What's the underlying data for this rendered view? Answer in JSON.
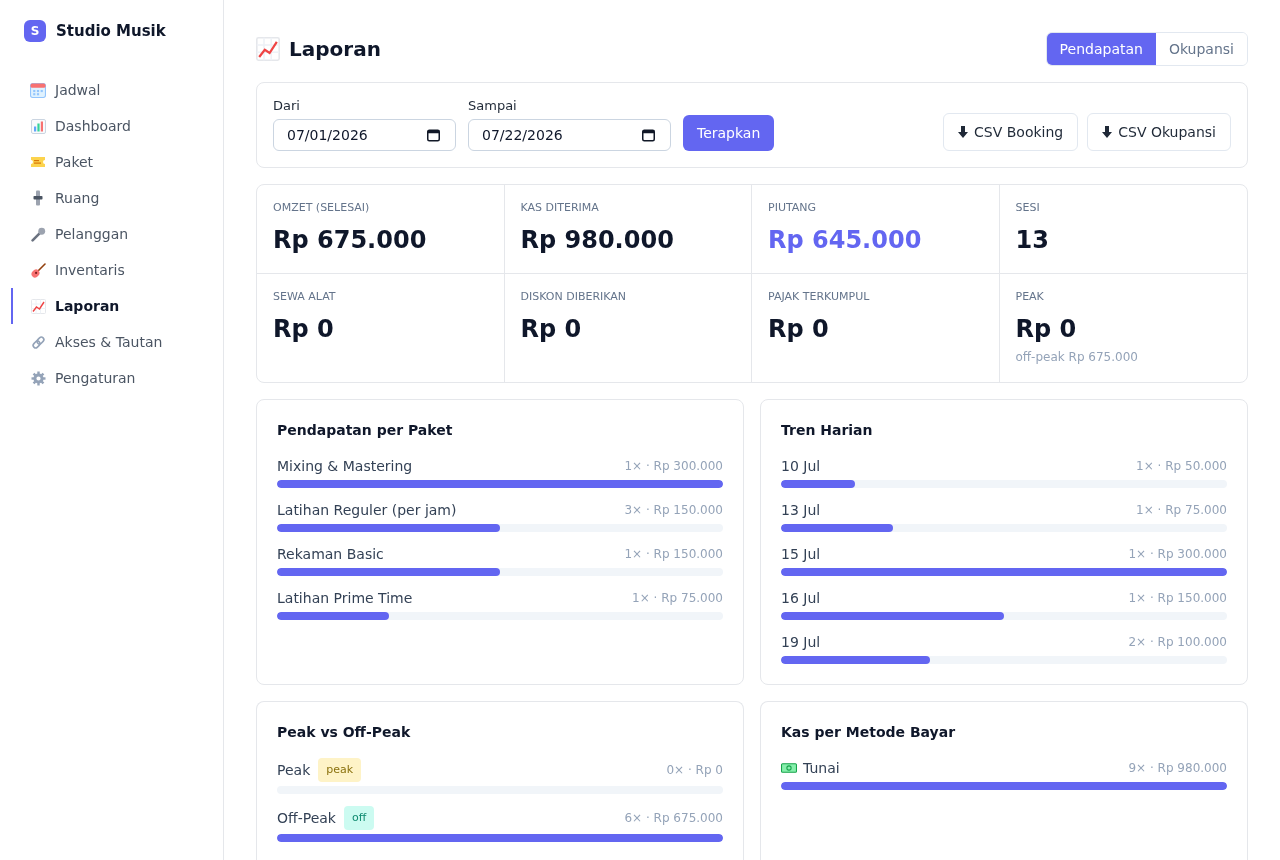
{
  "sidebar": {
    "brand": {
      "logo": "S",
      "name": "Studio Musik"
    },
    "items": [
      {
        "label": "Jadwal",
        "selected": false
      },
      {
        "label": "Dashboard",
        "selected": false
      },
      {
        "label": "Paket",
        "selected": false
      },
      {
        "label": "Ruang",
        "selected": false
      },
      {
        "label": "Pelanggan",
        "selected": false
      },
      {
        "label": "Inventaris",
        "selected": false
      },
      {
        "label": "Laporan",
        "selected": true
      },
      {
        "label": "Akses & Tautan",
        "selected": false
      },
      {
        "label": "Pengaturan",
        "selected": false
      }
    ]
  },
  "header": {
    "title": "Laporan",
    "view_tabs": [
      {
        "label": "Pendapatan",
        "selected": true
      },
      {
        "label": "Okupansi",
        "selected": false
      }
    ]
  },
  "filters": {
    "date_fields": [
      {
        "label": "Dari",
        "value": "07/01/2026"
      },
      {
        "label": "Sampai",
        "value": "07/22/2026"
      }
    ],
    "apply_button": "Terapkan",
    "export_buttons": [
      "CSV Booking",
      "CSV Okupansi"
    ]
  },
  "stats": [
    {
      "label": "OMZET (SELESAI)",
      "value": "Rp 675.000",
      "accent": false
    },
    {
      "label": "KAS DITERIMA",
      "value": "Rp 980.000",
      "accent": false
    },
    {
      "label": "PIUTANG",
      "value": "Rp 645.000",
      "accent": true
    },
    {
      "label": "SESI",
      "value": "13",
      "accent": false
    },
    {
      "label": "SEWA ALAT",
      "value": "Rp 0",
      "accent": false
    },
    {
      "label": "DISKON DIBERIKAN",
      "value": "Rp 0",
      "accent": false
    },
    {
      "label": "PAJAK TERKUMPUL",
      "value": "Rp 0",
      "accent": false
    },
    {
      "label": "PEAK",
      "value": "Rp 0",
      "note": "off-peak Rp 675.000",
      "accent": false
    }
  ],
  "panels": [
    {
      "title": "Pendapatan per Paket",
      "kind": "bars",
      "rows": [
        {
          "label": "Mixing & Mastering",
          "reading": "1× · Rp 300.000",
          "level": 1
        },
        {
          "label": "Latihan Reguler (per jam)",
          "reading": "3× · Rp 150.000",
          "level": 0.5
        },
        {
          "label": "Rekaman Basic",
          "reading": "1× · Rp 150.000",
          "level": 0.5
        },
        {
          "label": "Latihan Prime Time",
          "reading": "1× · Rp 75.000",
          "level": 0.25
        }
      ]
    },
    {
      "title": "Tren Harian",
      "kind": "bars",
      "rows": [
        {
          "label": "10 Jul",
          "reading": "1× · Rp 50.000",
          "level": 0.167
        },
        {
          "label": "13 Jul",
          "reading": "1× · Rp 75.000",
          "level": 0.25
        },
        {
          "label": "15 Jul",
          "reading": "1× · Rp 300.000",
          "level": 1
        },
        {
          "label": "16 Jul",
          "reading": "1× · Rp 150.000",
          "level": 0.5
        },
        {
          "label": "19 Jul",
          "reading": "2× · Rp 100.000",
          "level": 0.333
        }
      ]
    },
    {
      "title": "Peak vs Off-Peak",
      "kind": "bars",
      "rows": [
        {
          "label": "Peak",
          "badge": {
            "text": "peak",
            "color": "#fef3c7"
          },
          "reading": "0× · Rp 0",
          "level": 0
        },
        {
          "label": "Off-Peak",
          "badge": {
            "text": "off",
            "color": "#ccfbf1"
          },
          "reading": "6× · Rp 675.000",
          "level": 1
        }
      ]
    },
    {
      "title": "Kas per Metode Bayar",
      "kind": "payment",
      "rows": [
        {
          "label": "Tunai",
          "reading": "9× · Rp 980.000",
          "level": 1
        }
      ]
    }
  ]
}
